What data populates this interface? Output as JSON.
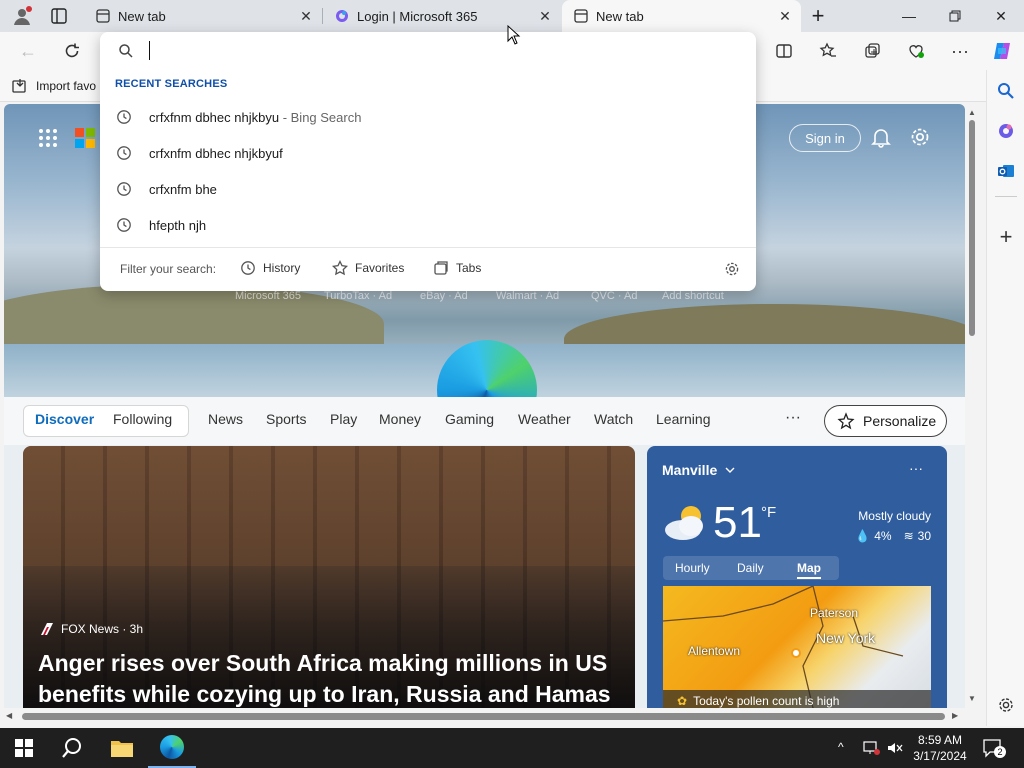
{
  "tabs": [
    {
      "title": "New tab"
    },
    {
      "title": "Login | Microsoft 365"
    },
    {
      "title": "New tab"
    }
  ],
  "favorites_bar": {
    "import_label": "Import favo"
  },
  "omnibox": {
    "section_title": "RECENT SEARCHES",
    "recent": [
      {
        "query": "crfxfnm dbhec nhjkbyu",
        "suffix": " - Bing Search"
      },
      {
        "query": "crfxnfm dbhec nhjkbyuf",
        "suffix": ""
      },
      {
        "query": "crfxnfm bhe",
        "suffix": ""
      },
      {
        "query": "hfepth njh",
        "suffix": ""
      }
    ],
    "filter_label": "Filter your search:",
    "filters": [
      "History",
      "Favorites",
      "Tabs"
    ]
  },
  "newtab": {
    "sign_in": "Sign in",
    "shortcuts": [
      "Microsoft 365",
      "TurboTax · Ad",
      "eBay · Ad",
      "Walmart · Ad",
      "QVC · Ad",
      "Add shortcut"
    ]
  },
  "feed_nav": {
    "items": [
      "Discover",
      "Following",
      "News",
      "Sports",
      "Play",
      "Money",
      "Gaming",
      "Weather",
      "Watch",
      "Learning"
    ],
    "personalize": "Personalize"
  },
  "news_card": {
    "source": "FOX News · 3h",
    "headline": "Anger rises over South Africa making millions in US benefits while cozying up to Iran, Russia and Hamas"
  },
  "weather": {
    "location": "Manville",
    "temp": "51",
    "unit": "°F",
    "condition": "Mostly cloudy",
    "precip": "4%",
    "aqi": "30",
    "tabs": [
      "Hourly",
      "Daily",
      "Map"
    ],
    "map_labels": [
      "Paterson",
      "New York",
      "Allentown"
    ],
    "pollen": "Today's pollen count is high"
  },
  "taskbar": {
    "time": "8:59 AM",
    "date": "3/17/2024",
    "notifications": "2"
  },
  "colors": {
    "accent": "#0f6cbd",
    "taskbar": "#1f1f1f",
    "weather_bg": "#2f5d9e"
  }
}
